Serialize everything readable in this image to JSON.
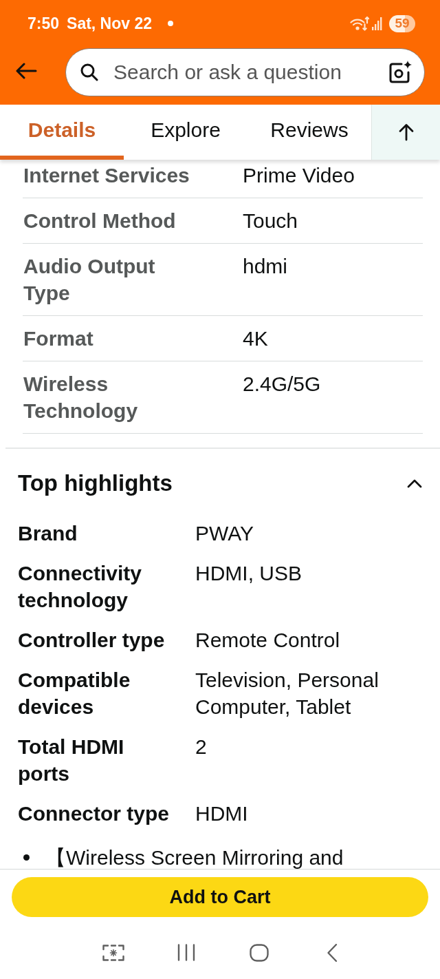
{
  "status_bar": {
    "time": "7:50",
    "date": "Sat, Nov 22",
    "battery": "59"
  },
  "search": {
    "placeholder": "Search or ask a question"
  },
  "tabs": [
    {
      "label": "Details",
      "selected": true
    },
    {
      "label": "Explore",
      "selected": false
    },
    {
      "label": "Reviews",
      "selected": false
    }
  ],
  "specifications": [
    {
      "label": "Internet Services",
      "value": "Prime Video"
    },
    {
      "label": "Control Method",
      "value": "Touch"
    },
    {
      "label": "Audio Output Type",
      "value": "hdmi"
    },
    {
      "label": "Format",
      "value": "4K"
    },
    {
      "label": "Wireless Technology",
      "value": "2.4G/5G"
    }
  ],
  "top_highlights": {
    "title": "Top highlights",
    "expanded": true,
    "rows": [
      {
        "label": "Brand",
        "value": "PWAY"
      },
      {
        "label": "Connectivity technology",
        "value": "HDMI, USB"
      },
      {
        "label": "Controller type",
        "value": "Remote Control"
      },
      {
        "label": "Compatible devices",
        "value": "Television, Personal Computer, Tablet"
      },
      {
        "label": "Total HDMI ports",
        "value": "2"
      },
      {
        "label": "Connector type",
        "value": "HDMI"
      }
    ],
    "bullets": [
      "【Wireless Screen Mirroring and"
    ]
  },
  "cart": {
    "button": "Add to Cart"
  }
}
